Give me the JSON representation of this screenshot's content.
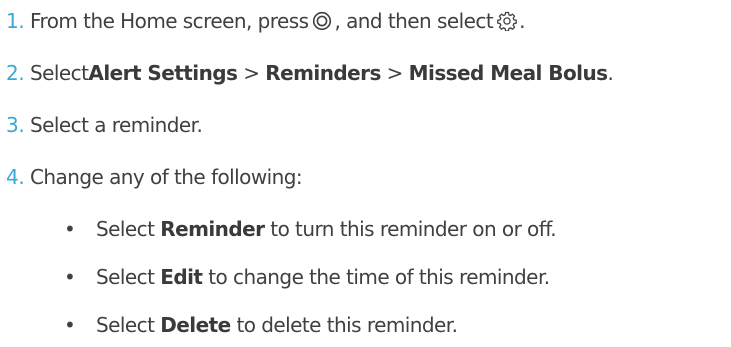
{
  "steps": [
    {
      "number": "1.",
      "text_before_icon1": "From the Home screen, press",
      "icon1": "menu-button-icon",
      "text_between_icons": ", and then select",
      "icon2": "settings-gear-icon",
      "text_after_icon2": "."
    },
    {
      "number": "2.",
      "text_before": "Select ",
      "bold1": "Alert Settings",
      "sep1": " > ",
      "bold2": "Reminders",
      "sep2": " > ",
      "bold3": "Missed Meal Bolus",
      "text_after": "."
    },
    {
      "number": "3.",
      "text": "Select a reminder."
    },
    {
      "number": "4.",
      "text": "Change any of the following:"
    }
  ],
  "bullets": [
    {
      "symbol": "•",
      "before": "Select ",
      "bold": "Reminder",
      "after": " to turn this reminder on or off."
    },
    {
      "symbol": "•",
      "before": "Select ",
      "bold": "Edit",
      "after": " to change the time of this reminder."
    },
    {
      "symbol": "•",
      "before": "Select ",
      "bold": "Delete",
      "after": " to delete this reminder."
    }
  ],
  "colors": {
    "step_number": "#3aa7d6",
    "body_text": "#404040"
  }
}
